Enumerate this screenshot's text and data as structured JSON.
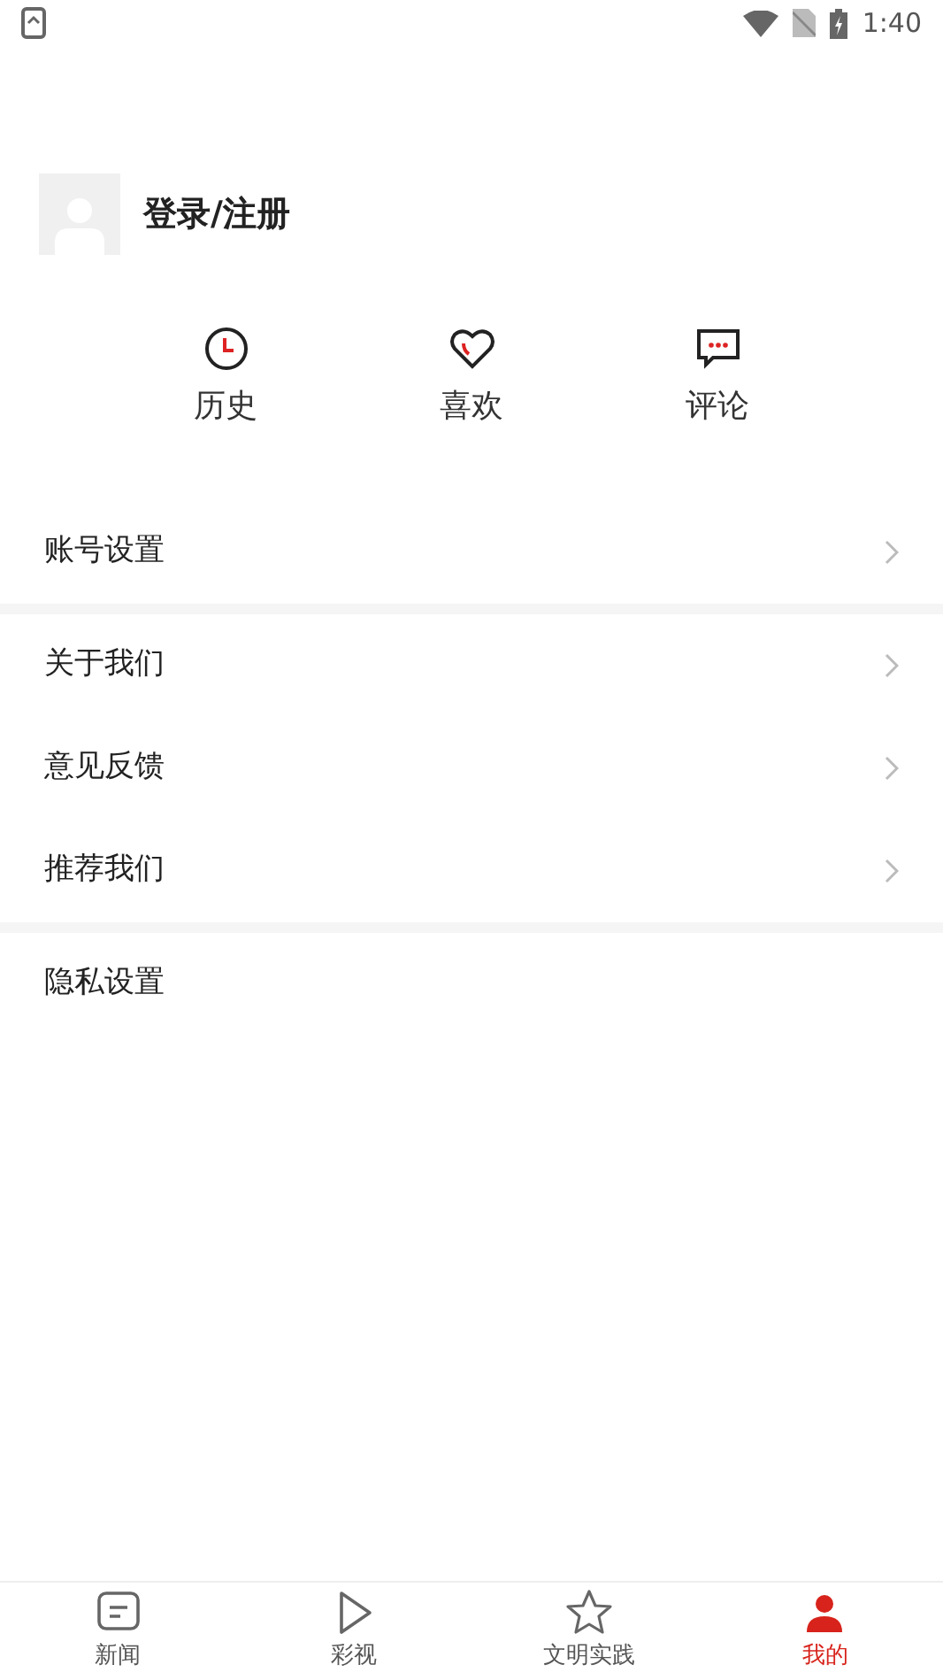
{
  "status_bar": {
    "time": "1:40"
  },
  "profile": {
    "login_label": "登录/注册"
  },
  "shortcuts": [
    {
      "kind": "history",
      "label": "历史"
    },
    {
      "kind": "like",
      "label": "喜欢"
    },
    {
      "kind": "comment",
      "label": "评论"
    }
  ],
  "menu_groups": [
    [
      {
        "label": "账号设置",
        "chevron": true
      }
    ],
    [
      {
        "label": "关于我们",
        "chevron": true
      },
      {
        "label": "意见反馈",
        "chevron": true
      },
      {
        "label": "推荐我们",
        "chevron": true
      }
    ],
    [
      {
        "label": "隐私设置",
        "chevron": false
      }
    ]
  ],
  "bottom_nav": [
    {
      "kind": "news",
      "label": "新闻",
      "selected": false
    },
    {
      "kind": "video",
      "label": "彩视",
      "selected": false
    },
    {
      "kind": "star",
      "label": "文明实践",
      "selected": false
    },
    {
      "kind": "me",
      "label": "我的",
      "selected": true
    }
  ]
}
